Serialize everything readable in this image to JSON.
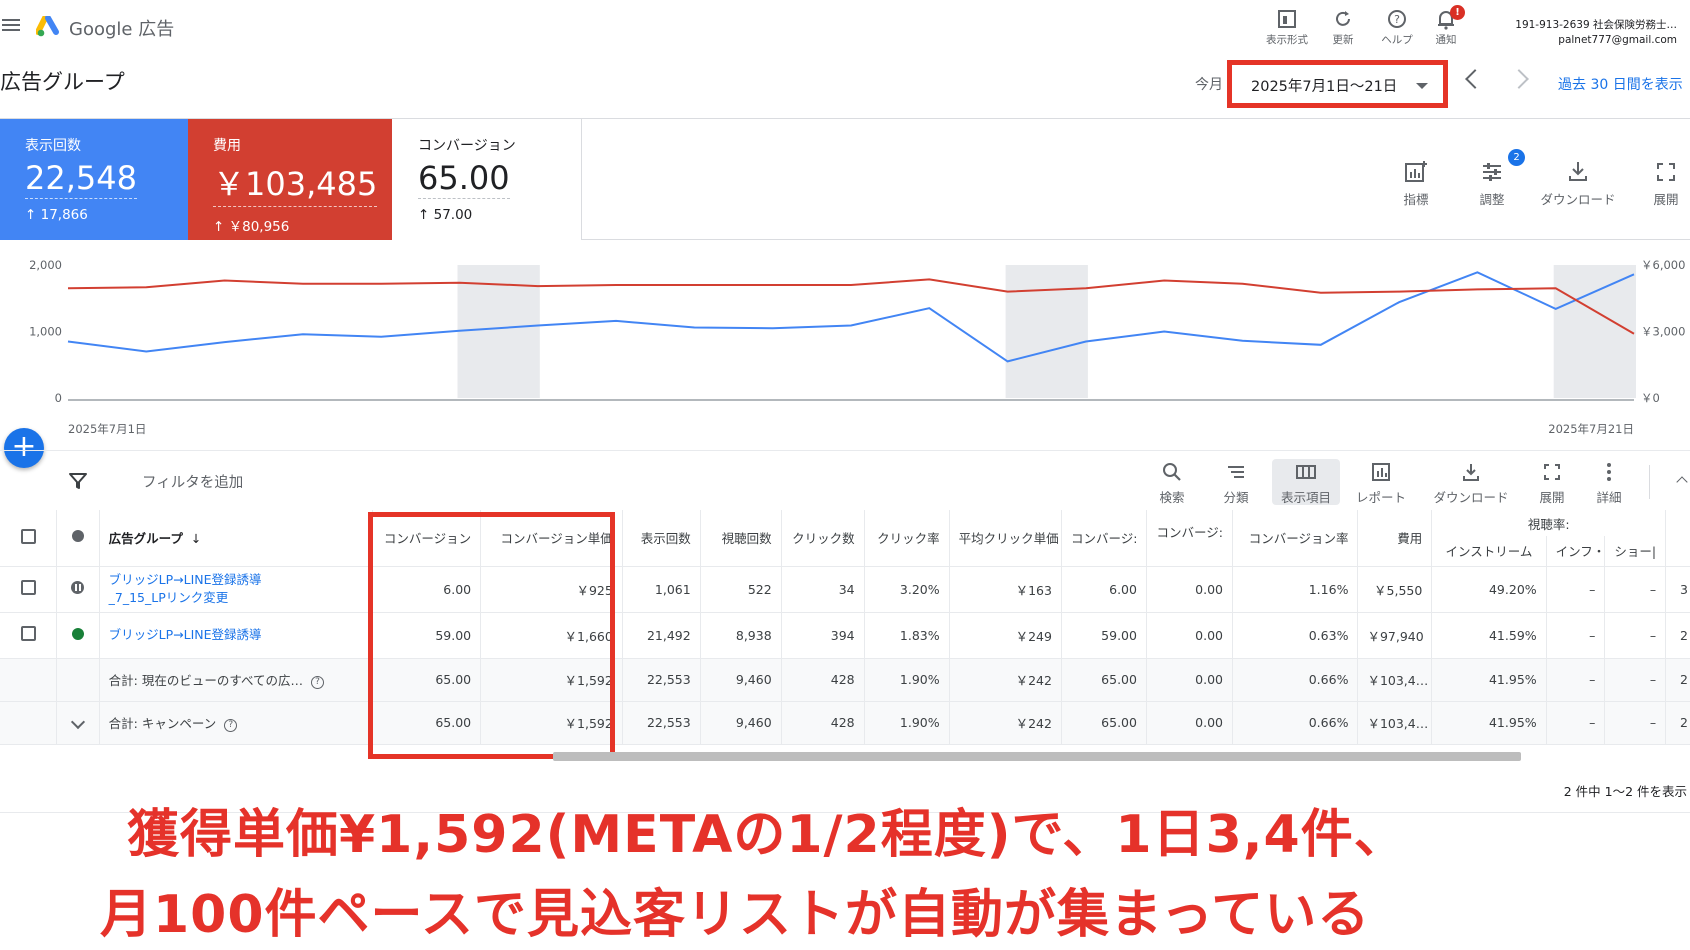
{
  "app": {
    "product_name": "Google 広告"
  },
  "topbar": {
    "tools": [
      {
        "icon": "view-format-icon",
        "label": "表示形式"
      },
      {
        "icon": "refresh-icon",
        "label": "更新"
      },
      {
        "icon": "help-icon",
        "label": "ヘルプ"
      },
      {
        "icon": "bell-icon",
        "label": "通知"
      }
    ],
    "notification_badge": "!",
    "account_line1": "191-913-2639 社会保険労務士…",
    "account_line2": "palnet777@gmail.com"
  },
  "header": {
    "title": "広告グループ",
    "date_label": "今月",
    "date_range": "2025年7月1日〜21日",
    "last30_link": "過去 30 日間を表示"
  },
  "scorecards": [
    {
      "label": "表示回数",
      "value": "22,548",
      "compare": "↑ 17,866"
    },
    {
      "label": "費用",
      "value": "￥103,485",
      "compare": "↑ ￥80,956"
    },
    {
      "label": "コンバージョン",
      "value": "65.00",
      "compare": "↑ 57.00"
    }
  ],
  "card_tools": [
    {
      "icon": "metrics-icon",
      "label": "指標"
    },
    {
      "icon": "adjust-icon",
      "label": "調整",
      "badge": "2"
    },
    {
      "icon": "download-icon",
      "label": "ダウンロード"
    },
    {
      "icon": "expand-icon",
      "label": "展開"
    }
  ],
  "chart_data": {
    "type": "line",
    "x": [
      "2025-07-01",
      "2025-07-02",
      "2025-07-03",
      "2025-07-04",
      "2025-07-05",
      "2025-07-06",
      "2025-07-07",
      "2025-07-08",
      "2025-07-09",
      "2025-07-10",
      "2025-07-11",
      "2025-07-12",
      "2025-07-13",
      "2025-07-14",
      "2025-07-15",
      "2025-07-16",
      "2025-07-17",
      "2025-07-18",
      "2025-07-19",
      "2025-07-20",
      "2025-07-21"
    ],
    "x_tick_labels": [
      "2025年7月1日",
      "2025年7月21日"
    ],
    "series": [
      {
        "axis": "left",
        "color": "#4285f4",
        "values": [
          850,
          700,
          840,
          960,
          920,
          1010,
          1090,
          1160,
          1060,
          1050,
          1090,
          1350,
          550,
          850,
          1000,
          860,
          800,
          1440,
          1890,
          1340,
          1860
        ]
      },
      {
        "axis": "right",
        "color": "#d23f31",
        "values": [
          4950,
          5000,
          5300,
          5150,
          5150,
          5200,
          5050,
          5100,
          5100,
          5100,
          5100,
          5350,
          4800,
          4950,
          5300,
          5150,
          4750,
          4800,
          4900,
          4950,
          2900
        ]
      }
    ],
    "left_ticks": [
      "2,000",
      "1,000",
      "0"
    ],
    "right_ticks": [
      "￥6,000",
      "￥3,000",
      "￥0"
    ],
    "ylim_left": [
      0,
      2000
    ],
    "ylim_right": [
      0,
      6000
    ],
    "weekend_shading": [
      [
        5,
        6
      ],
      [
        12,
        13
      ],
      [
        19,
        20
      ]
    ],
    "grid": false
  },
  "filter": {
    "add_filter": "フィルタを追加"
  },
  "table_tools": [
    {
      "icon": "search-icon",
      "label": "検索"
    },
    {
      "icon": "segment-icon",
      "label": "分類"
    },
    {
      "icon": "columns-icon",
      "label": "表示項目"
    },
    {
      "icon": "report-icon",
      "label": "レポート"
    },
    {
      "icon": "download-icon",
      "label": "ダウンロード"
    },
    {
      "icon": "expand-icon",
      "label": "展開"
    },
    {
      "icon": "more-icon",
      "label": "詳細"
    }
  ],
  "table": {
    "name_header": "広告グループ",
    "headers": [
      "コンバージョン",
      "コンバージョン単価",
      "表示回数",
      "視聴回数",
      "クリック数",
      "クリック率",
      "平均クリック単価",
      "コンバージ:",
      "コンバージ:",
      "コンバージョン率",
      "費用"
    ],
    "view_rate_group": "視聴率:",
    "view_rate_sub": [
      "インストリーム",
      "インフ・",
      "ショー|"
    ],
    "rows": [
      {
        "status": "paused",
        "name": "ブリッジLP→LINE登録誘導_7_15_LPリンク変更",
        "cells": [
          "6.00",
          "￥925",
          "1,061",
          "522",
          "34",
          "3.20%",
          "￥163",
          "6.00",
          "0.00",
          "1.16%",
          "￥5,550",
          "49.20%",
          "–",
          "–",
          "3"
        ]
      },
      {
        "status": "enabled",
        "name": "ブリッジLP→LINE登録誘導",
        "cells": [
          "59.00",
          "￥1,660",
          "21,492",
          "8,938",
          "394",
          "1.83%",
          "￥249",
          "59.00",
          "0.00",
          "0.63%",
          "￥97,940",
          "41.59%",
          "–",
          "–",
          "2"
        ]
      }
    ],
    "totals": [
      {
        "label": "合計: 現在のビューのすべての広…",
        "cells": [
          "65.00",
          "￥1,592",
          "22,553",
          "9,460",
          "428",
          "1.90%",
          "￥242",
          "65.00",
          "0.00",
          "0.66%",
          "￥103,4…",
          "41.95%",
          "–",
          "–",
          "2"
        ]
      },
      {
        "label": "合計: キャンペーン",
        "cells": [
          "65.00",
          "￥1,592",
          "22,553",
          "9,460",
          "428",
          "1.90%",
          "￥242",
          "65.00",
          "0.00",
          "0.66%",
          "￥103,4…",
          "41.95%",
          "–",
          "–",
          "2"
        ]
      }
    ],
    "pagination": "2 件中 1〜2 件を表示"
  },
  "caption": {
    "line1": "獲得単価¥1,592(METAの1/2程度)で、1日3,4件、",
    "line2": "月100件ペースで見込客リストが自動が集まっている"
  },
  "colors": {
    "blue": "#4285f4",
    "red": "#d23f31",
    "accent": "#1a73e8",
    "highlight": "#e53427"
  }
}
